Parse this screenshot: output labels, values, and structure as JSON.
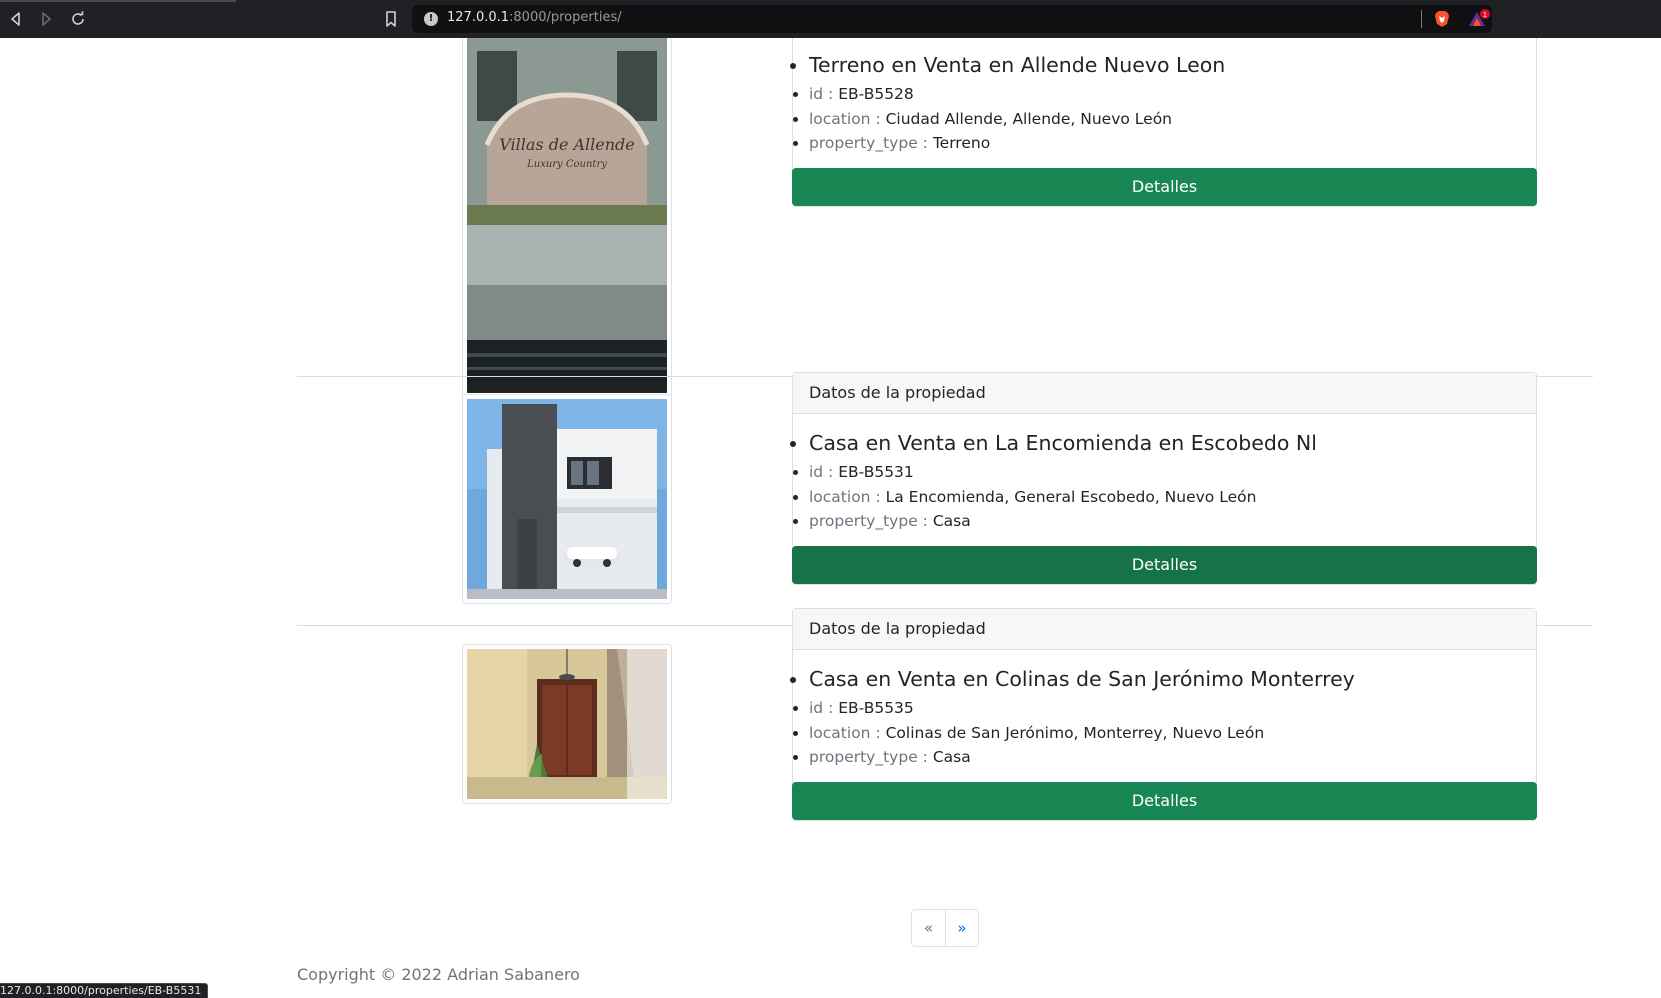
{
  "browser": {
    "url_host": "127.0.0.1",
    "url_path": ":8000/properties/",
    "notification_count": "1",
    "status_url": "127.0.0.1:8000/properties/EB-B5531"
  },
  "properties": [
    {
      "header": "",
      "title": "Terreno en Venta en Allende Nuevo Leon",
      "id_key": "id :",
      "id": "EB-B5528",
      "location_key": "location :",
      "location": "Ciudad Allende, Allende, Nuevo León",
      "type_key": "property_type :",
      "property_type": "Terreno",
      "button": "Detalles",
      "image_text": [
        "Villas de Allende",
        "Luxury Country"
      ]
    },
    {
      "header": "Datos de la propiedad",
      "title": "Casa en Venta en La Encomienda en Escobedo Nl",
      "id_key": "id :",
      "id": "EB-B5531",
      "location_key": "location :",
      "location": "La Encomienda, General Escobedo, Nuevo León",
      "type_key": "property_type :",
      "property_type": "Casa",
      "button": "Detalles"
    },
    {
      "header": "Datos de la propiedad",
      "title": "Casa en Venta en Colinas de San Jerónimo Monterrey",
      "id_key": "id :",
      "id": "EB-B5535",
      "location_key": "location :",
      "location": "Colinas de San Jerónimo, Monterrey, Nuevo León",
      "type_key": "property_type :",
      "property_type": "Casa",
      "button": "Detalles"
    }
  ],
  "pagination": {
    "prev": "«",
    "next": "»"
  },
  "footer": {
    "copyright": "Copyright © 2022 Adrian Sabanero"
  },
  "colors": {
    "success": "#198754",
    "chrome": "#202124",
    "link": "#0d6efd"
  }
}
